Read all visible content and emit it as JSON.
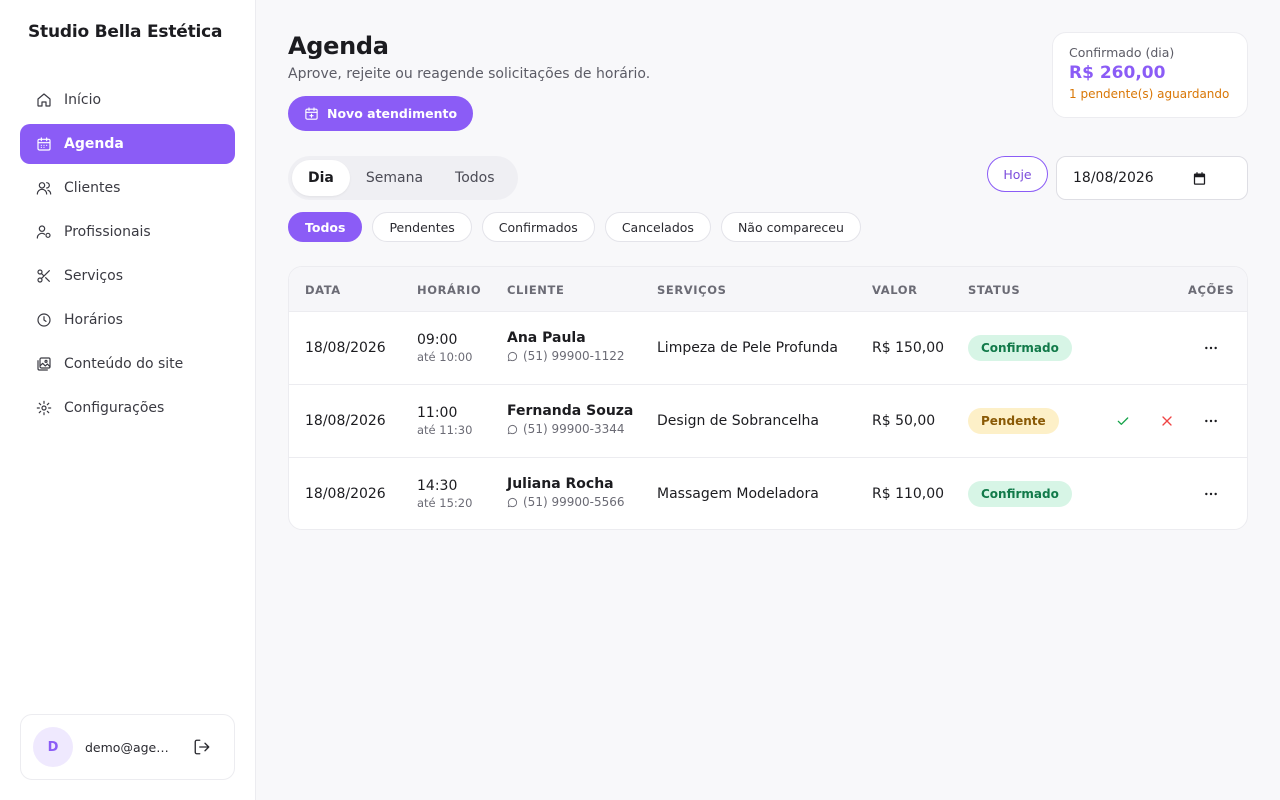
{
  "brand": "Studio Bella Estética",
  "nav": [
    {
      "label": "Início",
      "icon": "home-icon",
      "active": false
    },
    {
      "label": "Agenda",
      "icon": "calendar-icon",
      "active": true
    },
    {
      "label": "Clientes",
      "icon": "users-icon",
      "active": false
    },
    {
      "label": "Profissionais",
      "icon": "user-cog-icon",
      "active": false
    },
    {
      "label": "Serviços",
      "icon": "scissors-icon",
      "active": false
    },
    {
      "label": "Horários",
      "icon": "clock-icon",
      "active": false
    },
    {
      "label": "Conteúdo do site",
      "icon": "images-icon",
      "active": false
    },
    {
      "label": "Configurações",
      "icon": "gear-icon",
      "active": false
    }
  ],
  "user": {
    "initial": "D",
    "email": "demo@agenda.com"
  },
  "page": {
    "title": "Agenda",
    "subtitle": "Aprove, rejeite ou reagende solicitações de horário.",
    "new_button": "Novo atendimento"
  },
  "summary": {
    "label": "Confirmado (dia)",
    "value": "R$ 260,00",
    "pending": "1 pendente(s) aguardando"
  },
  "view_tabs": [
    "Dia",
    "Semana",
    "Todos"
  ],
  "today_label": "Hoje",
  "date_value": "18/08/2026",
  "filters": [
    "Todos",
    "Pendentes",
    "Confirmados",
    "Cancelados",
    "Não compareceu"
  ],
  "table": {
    "headers": {
      "date": "DATA",
      "time": "HORÁRIO",
      "client": "CLIENTE",
      "services": "SERVIÇOS",
      "value": "VALOR",
      "status": "STATUS",
      "actions": "AÇÕES"
    },
    "rows": [
      {
        "date": "18/08/2026",
        "start": "09:00",
        "end": "até 10:00",
        "client": "Ana Paula",
        "phone": "(51) 99900-1122",
        "service": "Limpeza de Pele Profunda",
        "value": "R$ 150,00",
        "status": "Confirmado",
        "status_kind": "ok"
      },
      {
        "date": "18/08/2026",
        "start": "11:00",
        "end": "até 11:30",
        "client": "Fernanda Souza",
        "phone": "(51) 99900-3344",
        "service": "Design de Sobrancelha",
        "value": "R$ 50,00",
        "status": "Pendente",
        "status_kind": "pend"
      },
      {
        "date": "18/08/2026",
        "start": "14:30",
        "end": "até 15:20",
        "client": "Juliana Rocha",
        "phone": "(51) 99900-5566",
        "service": "Massagem Modeladora",
        "value": "R$ 110,00",
        "status": "Confirmado",
        "status_kind": "ok"
      }
    ]
  },
  "colors": {
    "accent": "#8b5cf6",
    "pending": "#d97706",
    "confirm": "#16a34a",
    "reject": "#ef4444"
  }
}
